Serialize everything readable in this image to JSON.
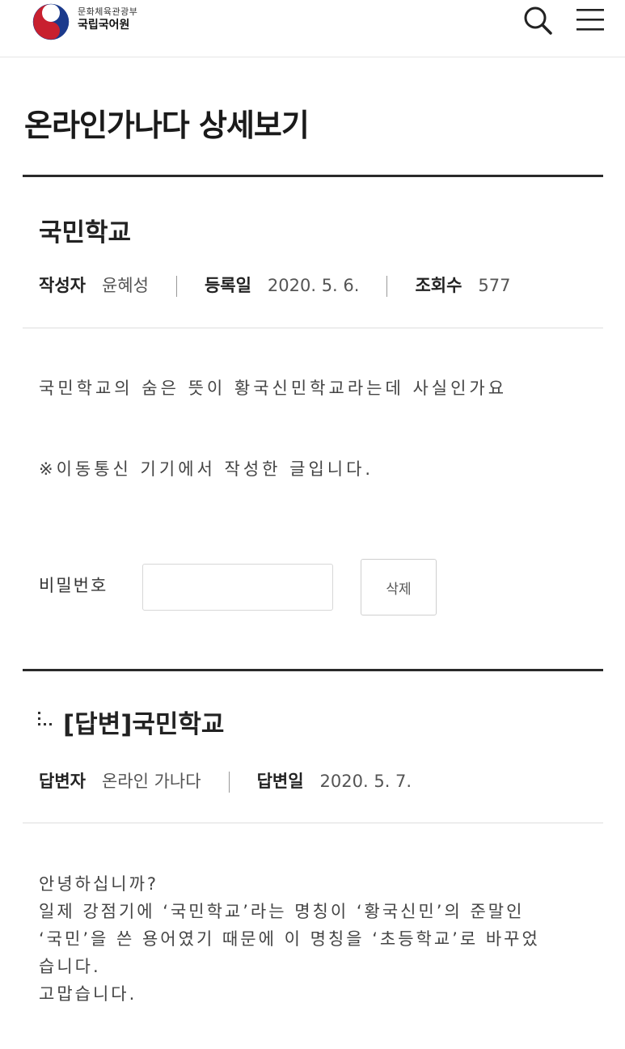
{
  "header": {
    "ministry": "문화체육관광부",
    "institute": "국립국어원",
    "icons": [
      "search-icon",
      "menu-icon"
    ]
  },
  "page": {
    "title": "온라인가나다 상세보기"
  },
  "post": {
    "title": "국민학교",
    "author_label": "작성자",
    "author": "윤혜성",
    "date_label": "등록일",
    "date": "2020. 5. 6.",
    "views_label": "조회수",
    "views": "577",
    "body": "국민학교의 숨은 뜻이 황국신민학교라는데 사실인가요",
    "note": "※이동통신 기기에서 작성한 글입니다."
  },
  "password": {
    "label": "비밀번호",
    "value": "",
    "delete_label": "삭제"
  },
  "reply": {
    "title": "[답변]국민학교",
    "responder_label": "답변자",
    "responder": "온라인 가나다",
    "date_label": "답변일",
    "date": "2020. 5. 7.",
    "lines": [
      "안녕하십니까?",
      "일제 강점기에 ‘국민학교’라는 명칭이 ‘황국신민’의 준말인",
      "‘국민’을 쓴 용어였기 때문에 이 명칭을 ‘초등학교’로 바꾸었",
      "습니다.",
      "고맙습니다."
    ]
  },
  "colors": {
    "accent_rule": "#2a2a2a",
    "text": "#222222",
    "muted": "#555555"
  }
}
